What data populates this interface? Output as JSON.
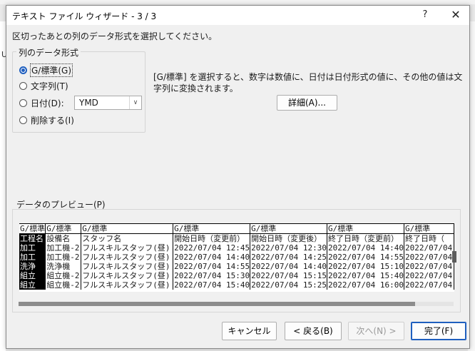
{
  "dialog": {
    "title": "テキスト ファイル ウィザード - 3 / 3",
    "help": "?",
    "close": "✕"
  },
  "instruction": "区切ったあとの列のデータ形式を選択してください。",
  "format_group": {
    "legend": "列のデータ形式",
    "options": [
      {
        "label": "G/標準(G)",
        "checked": true
      },
      {
        "label": "文字列(T)",
        "checked": false
      },
      {
        "label": "日付(D):",
        "checked": false
      },
      {
        "label": "削除する(I)",
        "checked": false
      }
    ],
    "date_format": "YMD",
    "dropdown_arrow": "∨"
  },
  "description": "[G/標準] を選択すると、数字は数値に、日付は日付形式の値に、その他の値は文字列に変換されます。",
  "detail_button": "詳細(A)...",
  "preview": {
    "label": "データのプレビュー(P)",
    "headers": [
      "G/標準",
      "G/標準",
      "G/標準",
      "G/標準",
      "G/標準",
      "G/標準",
      "G/標準"
    ],
    "rows": [
      [
        "工程名",
        "設備名",
        "スタッフ名",
        "開始日時（変更前）",
        "開始日時（変更後）",
        "終了日時（変更前）",
        "終了日時（"
      ],
      [
        "加工",
        "加工機-2",
        "フルスキルスタッフ(昼)",
        "2022/07/04 12:45",
        "2022/07/04 12:30",
        "2022/07/04 14:40",
        "2022/07/04"
      ],
      [
        "加工",
        "加工機-2",
        "フルスキルスタッフ(昼)",
        "2022/07/04 14:40",
        "2022/07/04 14:25",
        "2022/07/04 14:55",
        "2022/07/04"
      ],
      [
        "洗浄",
        "洗浄機",
        "フルスキルスタッフ(昼)",
        "2022/07/04 14:55",
        "2022/07/04 14:40",
        "2022/07/04 15:10",
        "2022/07/04"
      ],
      [
        "組立",
        "組立機-2",
        "フルスキルスタッフ(昼)",
        "2022/07/04 15:30",
        "2022/07/04 15:15",
        "2022/07/04 15:40",
        "2022/07/04"
      ],
      [
        "組立",
        "組立機-2",
        "フルスキルスタッフ(昼)",
        "2022/07/04 15:40",
        "2022/07/04 15:25",
        "2022/07/04 16:00",
        "2022/07/04"
      ]
    ]
  },
  "footer": {
    "cancel": "キャンセル",
    "back": "< 戻る(B)",
    "next": "次へ(N) >",
    "finish": "完了(F)"
  },
  "background": {
    "left_char": "U"
  },
  "colors": {
    "accent": "#1f5fbf",
    "selected_column_bg": "#000000"
  }
}
